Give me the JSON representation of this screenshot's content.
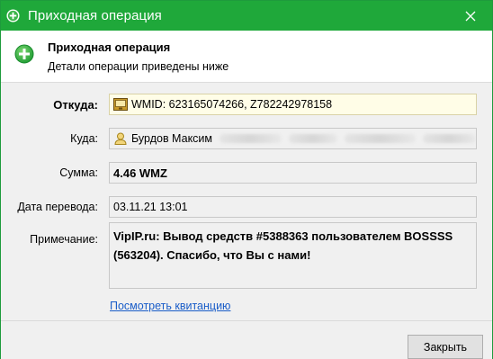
{
  "window": {
    "title": "Приходная операция"
  },
  "header": {
    "title": "Приходная операция",
    "subtitle": "Детали операции приведены ниже"
  },
  "fields": {
    "from": {
      "label": "Откуда:",
      "value": "WMID: 623165074266, Z782242978158"
    },
    "to": {
      "label": "Куда:",
      "value": "Бурдов Максим"
    },
    "amount": {
      "label": "Сумма:",
      "value": "4.46 WMZ"
    },
    "date": {
      "label": "Дата перевода:",
      "value": "03.11.21 13:01"
    },
    "note": {
      "label": "Примечание:",
      "line1": "VipIP.ru: Вывод средств #5388363 пользователем BOSSSS",
      "line2": "(563204). Спасибо, что Вы с нами!"
    }
  },
  "receipt_link": "Посмотреть квитанцию",
  "footer": {
    "close_button": "Закрыть"
  },
  "colors": {
    "titlebar": "#1fa83a",
    "from_field_bg": "#fffde7",
    "link": "#1a5dc8"
  },
  "icons": {
    "title": "plus-circle-icon",
    "header": "plus-circle-icon",
    "from": "wallet-icon",
    "to": "person-certificate-icon",
    "close": "close-icon"
  }
}
